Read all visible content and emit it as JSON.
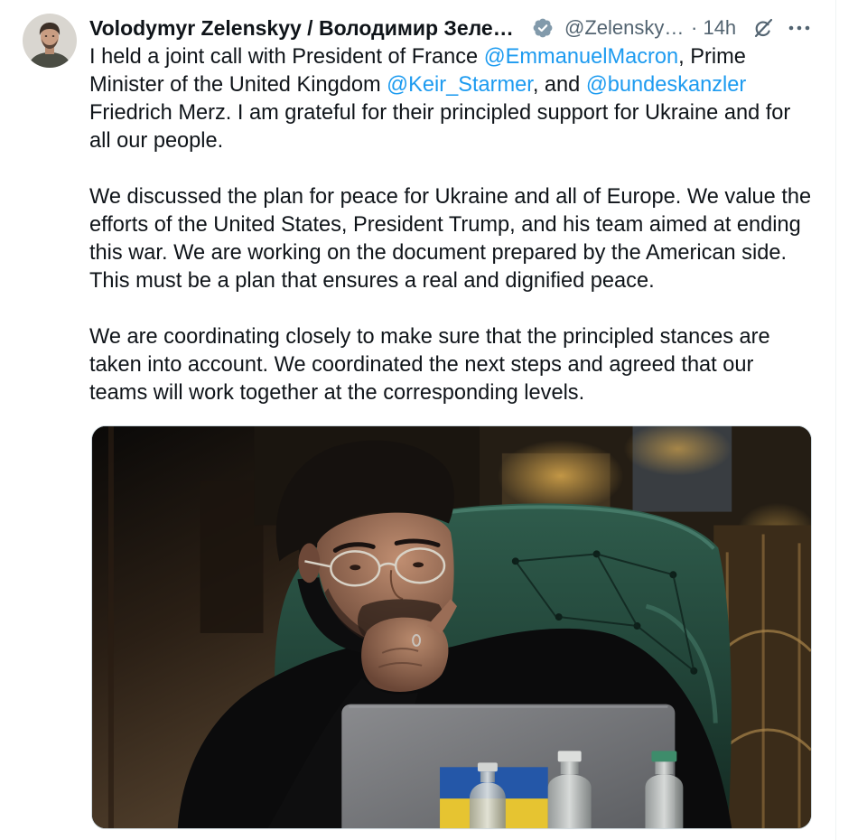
{
  "colors": {
    "text": "#0f1419",
    "secondary": "#536471",
    "link": "#1d9bf0",
    "badge": "#829aab",
    "divider": "#eff3f4",
    "background": "#ffffff"
  },
  "tweet": {
    "author": {
      "avatar_icon": "avatar",
      "display_name": "Volodymyr Zelenskyy / Володимир Зеле…",
      "verified_icon": "verified-badge-icon",
      "handle": "@Zelensky…",
      "separator": "·",
      "time": "14h"
    },
    "header_icons": {
      "grok": "grok-icon",
      "more": "more-icon"
    },
    "paragraphs": [
      {
        "lines": [
          [
            {
              "text": "I held a joint call with President of France "
            },
            {
              "text": "@EmmanuelMacron",
              "mention": true
            },
            {
              "text": ", Prime"
            }
          ],
          [
            {
              "text": "Minister of the United Kingdom "
            },
            {
              "text": "@Keir_Starmer",
              "mention": true
            },
            {
              "text": ", and "
            },
            {
              "text": "@bundeskanzler",
              "mention": true
            }
          ],
          [
            {
              "text": "Friedrich Merz. I am grateful for their principled support for Ukraine and for"
            }
          ],
          [
            {
              "text": "all our people."
            }
          ]
        ]
      },
      {
        "lines": [
          [
            {
              "text": "We discussed the plan for peace for Ukraine and all of Europe. We value the"
            }
          ],
          [
            {
              "text": "efforts of the United States, President Trump, and his team aimed at ending"
            }
          ],
          [
            {
              "text": "this war. We are working on the document prepared by the American side."
            }
          ],
          [
            {
              "text": "This must be a plan that ensures a real and dignified peace."
            }
          ]
        ]
      },
      {
        "lines": [
          [
            {
              "text": "We are coordinating closely to make sure that the principled stances are"
            }
          ],
          [
            {
              "text": "taken into account. We coordinated the next steps and agreed that our"
            }
          ],
          [
            {
              "text": "teams will work together at the corresponding levels."
            }
          ]
        ]
      }
    ]
  }
}
